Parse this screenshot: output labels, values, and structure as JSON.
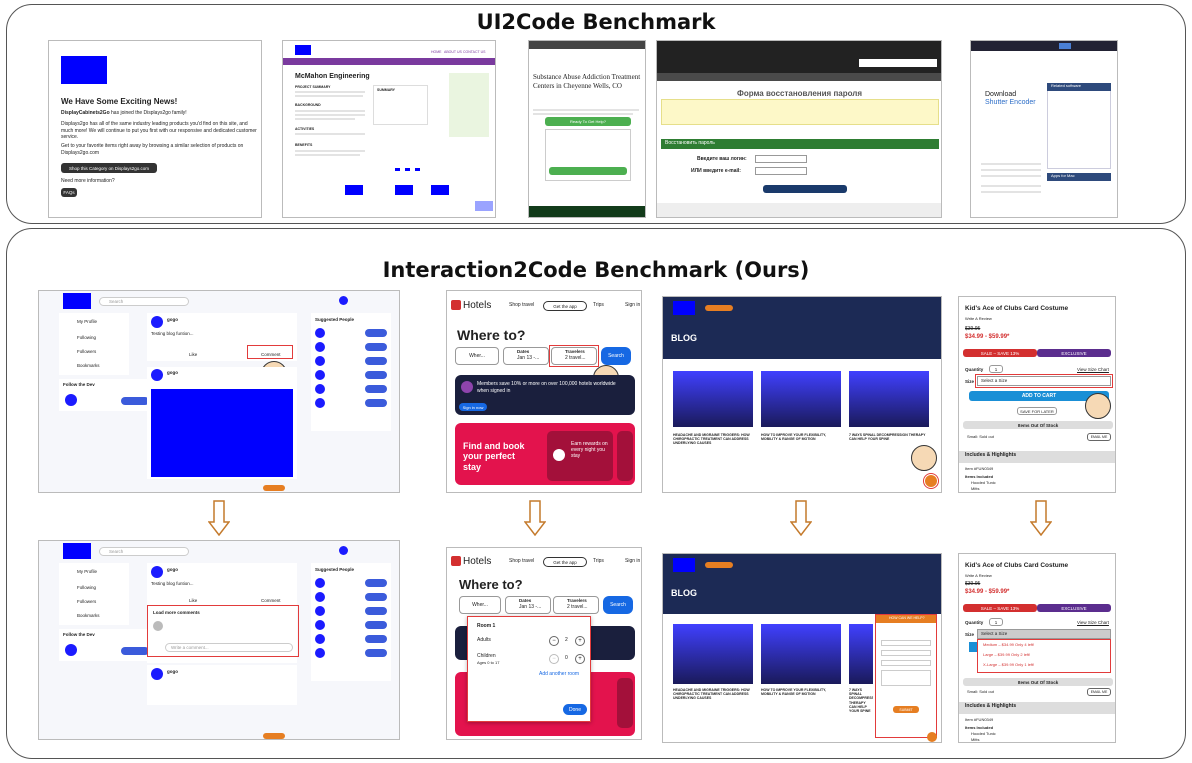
{
  "top_panel": {
    "title": "UI2Code Benchmark",
    "shot1": {
      "heading": "We Have Some Exciting News!",
      "para1_bold": "DisplayCabinets2Go",
      "para1_rest": " has joined the Displays2go family!",
      "para2": "Displays2go has all of the same industry leading products you'd find on this site, and much more! We will continue to put you first with our responsive and dedicated customer service.",
      "para3": "Get to your favorite items right away by browsing a similar selection of products on Displays2go.com",
      "button": "Shop this Category on Displays2go.com",
      "need_more": "Need more information?",
      "faq": "FAQs"
    },
    "shot2": {
      "nav": [
        "HOME",
        "ABOUT US",
        "CONTACT US"
      ],
      "heading": "McMahon Engineering",
      "section1": "PROJECT SUMMARY",
      "section2": "BACKGROUND",
      "section3": "ACTIVITIES",
      "section4": "BENEFITS",
      "summary": "SUMMARY"
    },
    "shot3": {
      "heading": "Substance Abuse Addiction Treatment Centers in Cheyenne Wells, CO",
      "button": "Ready To Get Help?"
    },
    "shot4": {
      "heading": "Форма восстановления пароля",
      "section": "Восстановить пароль",
      "label1": "Введите ваш логин:",
      "label2": "ИЛИ введите e-mail:"
    },
    "shot5": {
      "heading": "Download",
      "subheading": "Shutter Encoder",
      "sidebar_title": "Related software",
      "sidebar2_title": "Apps for Mac"
    }
  },
  "bottom_panel": {
    "title": "Interaction2Code Benchmark (Ours)",
    "social": {
      "search_placeholder": "Search",
      "menu": [
        "My Profile",
        "Following",
        "Followers",
        "Bookmarks"
      ],
      "follow_dev": "Follow the Dev",
      "user": "gogo",
      "post_text": "Testing blog funtion...",
      "like": "Like",
      "comment": "Comment",
      "suggested": "Suggested People",
      "load_more": "Load more comments",
      "write_comment": "Write a comment..."
    },
    "hotels": {
      "brand": "Hotels",
      "shop_travel": "Shop travel",
      "get_app": "Get the app",
      "trips": "Trips",
      "sign_in": "Sign in",
      "where_to": "Where to?",
      "where": "Wher...",
      "dates_label": "Dates",
      "dates_value": "Jan 13 -...",
      "travelers_label": "Travelers",
      "travelers_value": "2 travel...",
      "search": "Search",
      "members": "Members save 10% or more on over 100,000 hotels worldwide when signed in",
      "sign_in_now": "Sign in now",
      "find_book": "Find and book your perfect stay",
      "earn": "Earn rewards on every night you stay",
      "room": "Room 1",
      "adults": "Adults",
      "adults_count": "2",
      "children": "Children",
      "children_ages": "Ages 0 to 17",
      "children_count": "0",
      "add_room": "Add another room",
      "done": "Done"
    },
    "blog": {
      "badge": "BLOG",
      "posts": [
        "HEADACHE AND MIGRAINE TRIGGERS: HOW CHIROPRACTIC TREATMENT CAN ADDRESS UNDERLYING CAUSES",
        "HOW TO IMPROVE YOUR FLEXIBILITY, MOBILITY & RANGE OF MOTION",
        "7 WAYS SPINAL DECOMPRESSION THERAPY CAN HELP YOUR SPINE"
      ],
      "form_title": "HOW CAN WE HELP?",
      "form_button": "SUBMIT"
    },
    "costume": {
      "title": "Kid's Ace of Clubs Card Costume",
      "reviews": "Write A Review",
      "old_price": "$39.95",
      "price": "$34.99 - $59.99*",
      "sale": "SALE – SAVE 13%",
      "exclusive": "EXCLUSIVE",
      "quantity": "Quantity",
      "qty_value": "1",
      "size_chart": "View Size Chart",
      "size": "Size",
      "select_size": "Select a Size",
      "add_to_cart": "ADD TO CART",
      "save_later": "SAVE FOR LATER",
      "out_of_stock": "Items Out Of Stock",
      "sold_out": "Small: Sold out",
      "email_me": "EMAIL ME",
      "includes": "Includes & Highlights",
      "item_no": "Item #FUN0349",
      "items_included": "Items Included",
      "item1": "Hooded Tunic",
      "item2": "Mitts",
      "options": [
        "Medium – $34.99 Only 4 left!",
        "Large – $39.99 Only 2 left!",
        "X-Large – $39.99 Only 1 left!"
      ]
    }
  }
}
